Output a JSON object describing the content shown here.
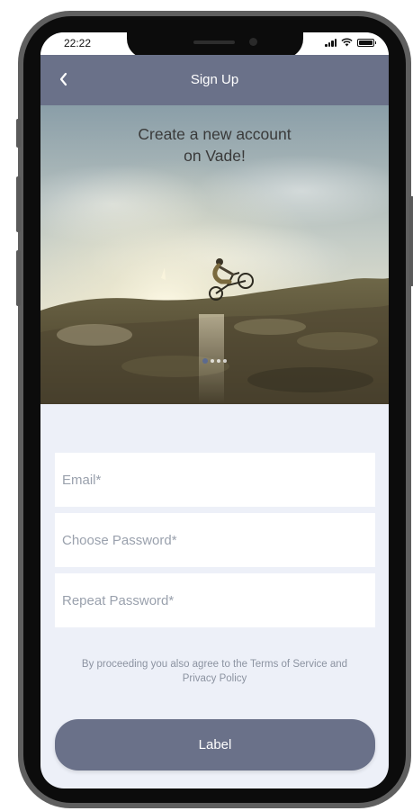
{
  "status_bar": {
    "time": "22:22"
  },
  "header": {
    "title": "Sign Up",
    "back_icon": "chevron-left-icon"
  },
  "hero": {
    "title_line1": "Create a new account",
    "title_line2": "on Vade!",
    "carousel_pages": 4,
    "carousel_active_index": 0
  },
  "form": {
    "email_placeholder": "Email*",
    "password_placeholder": "Choose Password*",
    "repeat_password_placeholder": "Repeat Password*"
  },
  "terms_text": "By proceeding you also agree to the Terms of Service and Privacy Policy",
  "submit_label": "Label",
  "colors": {
    "accent": "#6a7189",
    "background": "#edf0f8"
  }
}
